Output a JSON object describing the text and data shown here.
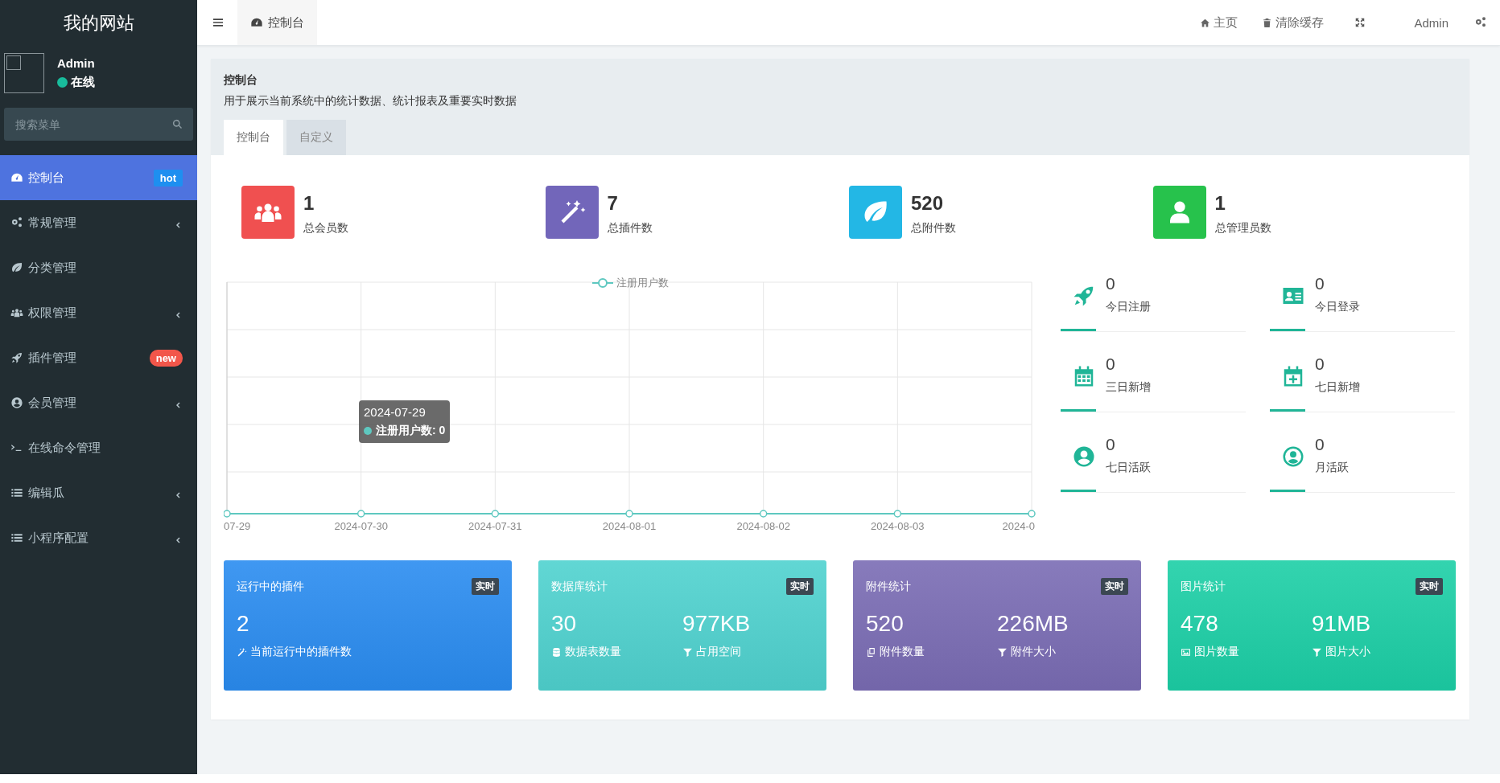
{
  "sidebar": {
    "site_title": "我的网站",
    "user": {
      "name": "Admin",
      "status": "在线",
      "online": true
    },
    "search": {
      "placeholder": "搜索菜单"
    },
    "items": [
      {
        "label": "控制台",
        "selected": true,
        "expandable": false,
        "badge": {
          "text": "hot",
          "kind": "label",
          "color": "#1e8ff0"
        }
      },
      {
        "label": "常规管理",
        "selected": false,
        "expandable": true
      },
      {
        "label": "分类管理",
        "selected": false,
        "expandable": false
      },
      {
        "label": "权限管理",
        "selected": false,
        "expandable": true
      },
      {
        "label": "插件管理",
        "selected": false,
        "expandable": false,
        "badge": {
          "text": "new",
          "kind": "pill",
          "color": "#f2564a"
        }
      },
      {
        "label": "会员管理",
        "selected": false,
        "expandable": true
      },
      {
        "label": "在线命令管理",
        "selected": false,
        "expandable": false
      },
      {
        "label": "编辑瓜",
        "selected": false,
        "expandable": true
      },
      {
        "label": "小程序配置",
        "selected": false,
        "expandable": true
      }
    ]
  },
  "header": {
    "tab": "控制台",
    "links": [
      {
        "label": "主页"
      },
      {
        "label": "清除缓存"
      }
    ],
    "user": "Admin"
  },
  "panel": {
    "title": "控制台",
    "description": "用于展示当前系统中的统计数据、统计报表及重要实时数据",
    "tabs": [
      {
        "label": "控制台",
        "selected": true
      },
      {
        "label": "自定义",
        "selected": false
      }
    ]
  },
  "stats": [
    {
      "value": "1",
      "label": "总会员数",
      "color": "#f05050"
    },
    {
      "value": "7",
      "label": "总插件数",
      "color": "#7266ba"
    },
    {
      "value": "520",
      "label": "总附件数",
      "color": "#23b7e5"
    },
    {
      "value": "1",
      "label": "总管理员数",
      "color": "#27c24c"
    }
  ],
  "chart": {
    "legend": "注册用户数",
    "x_labels": [
      "07-29",
      "2024-07-30",
      "2024-07-31",
      "2024-08-01",
      "2024-08-02",
      "2024-08-03",
      "2024-0"
    ],
    "tooltip": {
      "title": "2024-07-29",
      "text": "注册用户数: 0"
    }
  },
  "mini_stats": [
    {
      "value": "0",
      "label": "今日注册"
    },
    {
      "value": "0",
      "label": "今日登录"
    },
    {
      "value": "0",
      "label": "三日新增"
    },
    {
      "value": "0",
      "label": "七日新增"
    },
    {
      "value": "0",
      "label": "七日活跃"
    },
    {
      "value": "0",
      "label": "月活跃"
    }
  ],
  "cards": [
    {
      "title": "运行中的插件",
      "badge": "实时",
      "color": "#2a8cf0",
      "metrics": [
        {
          "value": "2",
          "label": "当前运行中的插件数"
        }
      ]
    },
    {
      "title": "数据库统计",
      "badge": "实时",
      "color": "#4fd2cf",
      "metrics": [
        {
          "value": "30",
          "label": "数据表数量"
        },
        {
          "value": "977KB",
          "label": "占用空间"
        }
      ]
    },
    {
      "title": "附件统计",
      "badge": "实时",
      "color": "#7a6cb4",
      "metrics": [
        {
          "value": "520",
          "label": "附件数量"
        },
        {
          "value": "226MB",
          "label": "附件大小"
        }
      ]
    },
    {
      "title": "图片统计",
      "badge": "实时",
      "color": "#1ccfa6",
      "metrics": [
        {
          "value": "478",
          "label": "图片数量"
        },
        {
          "value": "91MB",
          "label": "图片大小"
        }
      ]
    }
  ]
}
